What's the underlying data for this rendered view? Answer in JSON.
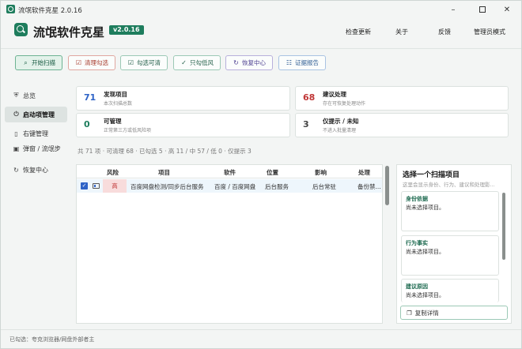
{
  "window": {
    "title": "流氓软件克星 2.0.16"
  },
  "header": {
    "app_title": "流氓软件克星",
    "version": "v2.0.16",
    "nav": [
      "检查更新",
      "关于",
      "反馈",
      "管理员模式"
    ]
  },
  "toolbar": {
    "start_scan": "开始扫描",
    "clean": "清理勾选",
    "select_cleanable": "勾选可清",
    "only_low_risk": "只勾低风",
    "recovery": "恢复中心",
    "evidence": "证据报告"
  },
  "sidebar": {
    "items": [
      {
        "label": "总览",
        "icon": "shield-icon"
      },
      {
        "label": "启动项管理",
        "icon": "power-icon",
        "active": true
      },
      {
        "label": "右键管理",
        "icon": "document-icon"
      },
      {
        "label": "弹窗 / 流氓步",
        "icon": "popup-window-icon"
      },
      {
        "label": "恢复中心",
        "icon": "restore-icon"
      }
    ]
  },
  "cards": [
    {
      "num": "71",
      "title": "发现项目",
      "sub": "本次扫描总数",
      "color": "#2e63c7"
    },
    {
      "num": "68",
      "title": "建议处理",
      "sub": "存在可恢复处理动作",
      "color": "#c03636"
    },
    {
      "num": "0",
      "title": "可管理",
      "sub": "正常第三方或低风险项",
      "color": "#1e7d5d"
    },
    {
      "num": "3",
      "title": "仅提示 / 未知",
      "sub": "不进入批量清理",
      "color": "#444444"
    }
  ],
  "summary": "共 71 项 · 可清理 68 · 已勾选 5 · 高 11 / 中 57 / 低 0 · 仅提示 3",
  "table": {
    "headers": [
      "风险",
      "项目",
      "软件",
      "位置",
      "影响",
      "处理"
    ],
    "rows": [
      {
        "risk": "高",
        "item": "百度网盘检测/同步后台服务",
        "software": "百度 / 百度网盘",
        "location": "后台服务",
        "impact": "后台常驻",
        "action": "备份禁..."
      }
    ]
  },
  "detail": {
    "title": "选择一个扫描项目",
    "subtitle": "这里会显示身份、行为、建议和处理影...",
    "sections": [
      {
        "title": "身份依据",
        "value": "尚未选择项目。"
      },
      {
        "title": "行为事实",
        "value": "尚未选择项目。"
      },
      {
        "title": "建议原因",
        "value": "尚未选择项目。"
      }
    ],
    "copy_label": "复制详情"
  },
  "status": "已勾选：夸克浏览器/网盘外部者主"
}
